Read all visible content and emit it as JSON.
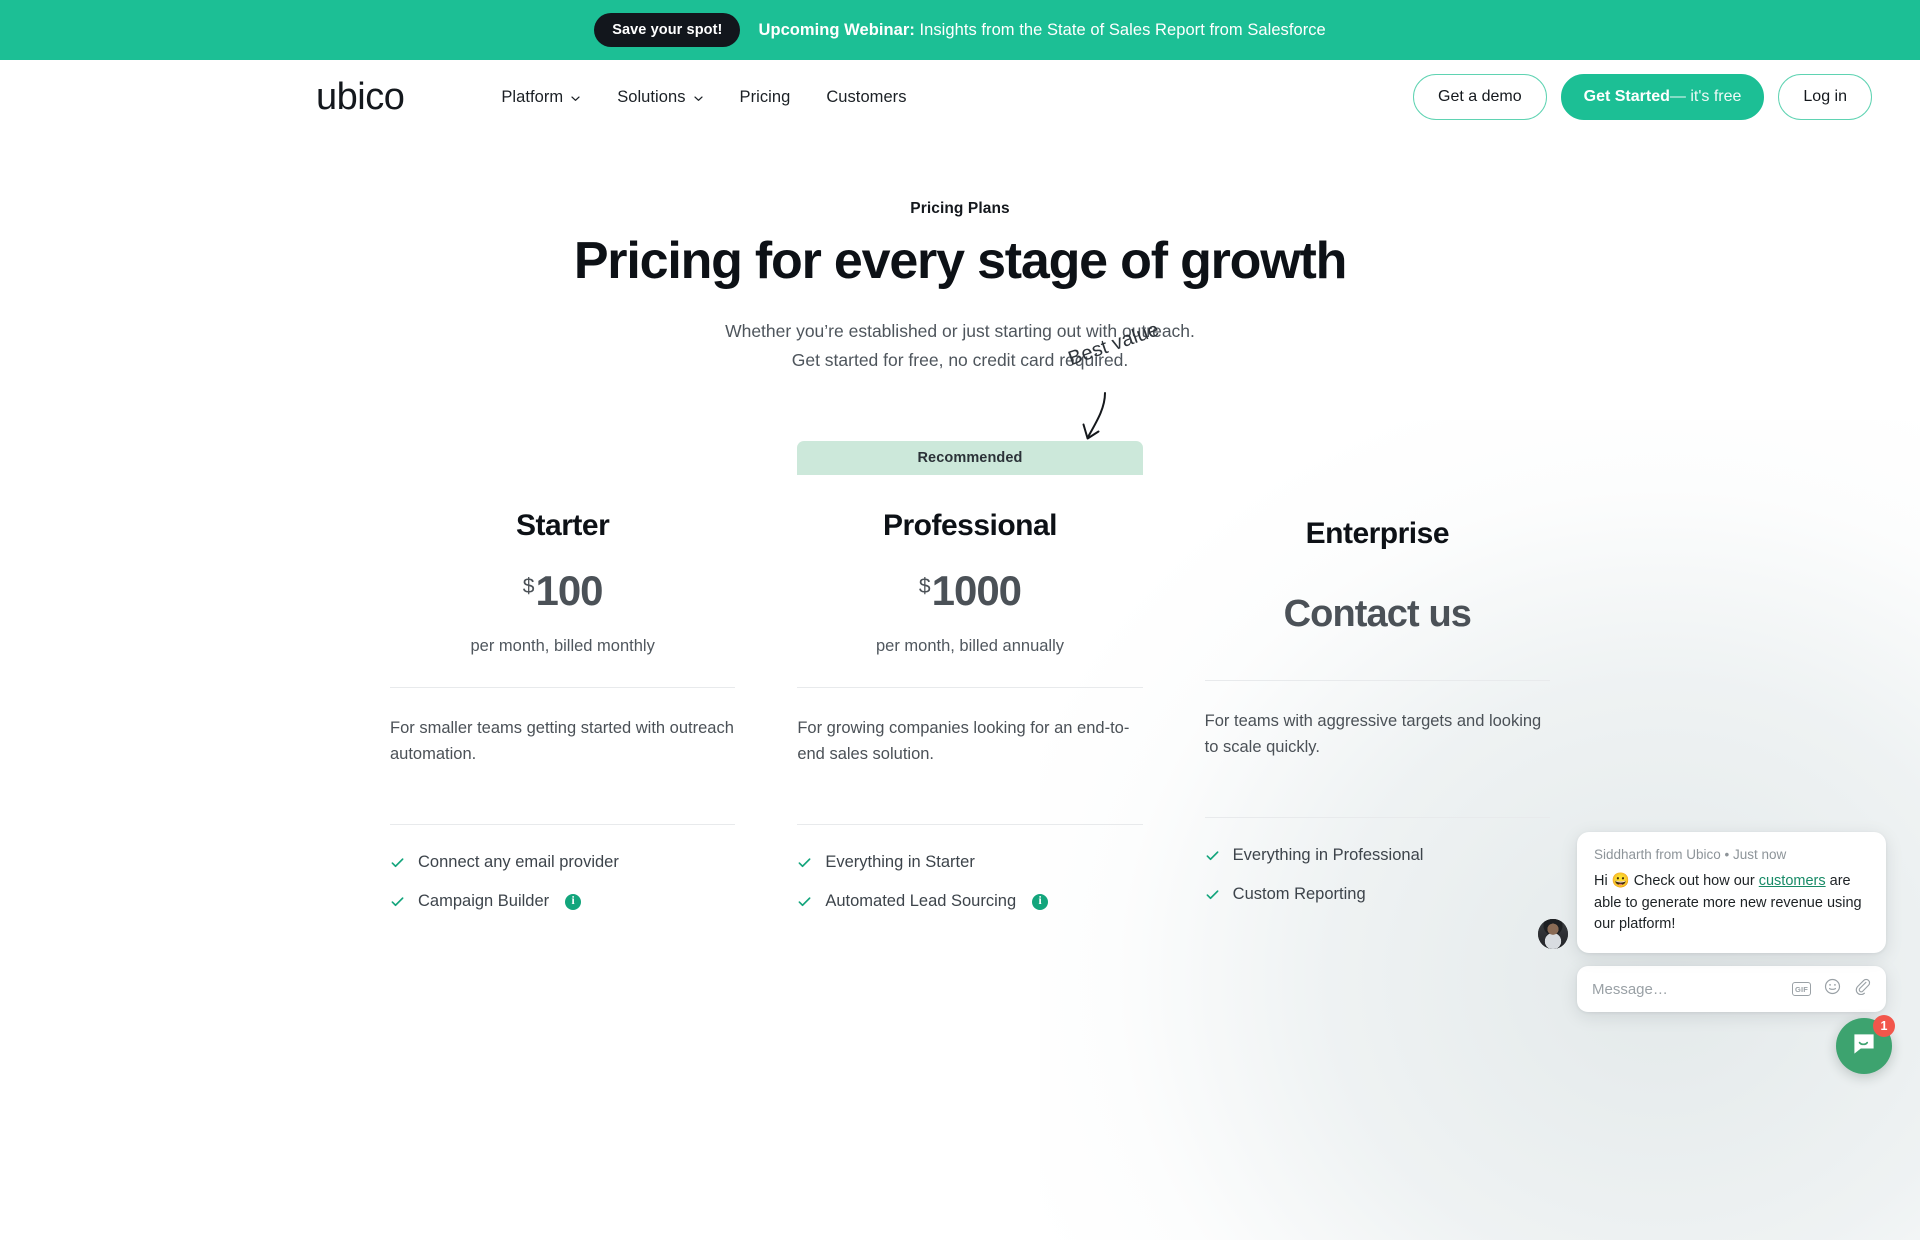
{
  "colors": {
    "brand_green": "#1cbf95",
    "ribbon_green": "#cce8da",
    "check_green": "#13a57c",
    "badge_red": "#f2564b",
    "launcher_green": "#3da36f",
    "dark": "#12161c"
  },
  "announcement": {
    "cta_label": "Save your spot!",
    "lead": "Upcoming Webinar:",
    "text": " Insights from the State of Sales Report from Salesforce"
  },
  "nav": {
    "logo": "ubico",
    "links": [
      {
        "label": "Platform",
        "has_caret": true
      },
      {
        "label": "Solutions",
        "has_caret": true
      },
      {
        "label": "Pricing",
        "has_caret": false
      },
      {
        "label": "Customers",
        "has_caret": false
      }
    ],
    "demo_label": "Get a demo",
    "get_started_strong": "Get Started",
    "get_started_light": "— it's free",
    "login_label": "Log in"
  },
  "hero": {
    "eyebrow": "Pricing Plans",
    "title": "Pricing for every stage of growth",
    "sub_line1": "Whether you’re established or just starting out with outreach.",
    "sub_line2": "Get started for free, no credit card required."
  },
  "annotation": {
    "best_value": "Best value",
    "ribbon": "Recommended"
  },
  "plans": [
    {
      "name": "Starter",
      "currency": "$",
      "amount": "100",
      "period": "per month, billed monthly",
      "description": "For smaller teams getting started with outreach automation.",
      "features": [
        {
          "label": "Connect any email provider",
          "info": false
        },
        {
          "label": "Campaign Builder",
          "info": true
        }
      ]
    },
    {
      "name": "Professional",
      "currency": "$",
      "amount": "1000",
      "period": "per month, billed annually",
      "description": "For growing companies looking for an end-to-end sales solution.",
      "features": [
        {
          "label": "Everything in Starter",
          "info": false
        },
        {
          "label": "Automated Lead Sourcing",
          "info": true
        }
      ]
    },
    {
      "name": "Enterprise",
      "contact_label": "Contact us",
      "description": "For teams with aggressive targets and looking to scale quickly.",
      "features": [
        {
          "label": "Everything in Professional",
          "info": false
        },
        {
          "label": "Custom Reporting",
          "info": false
        }
      ]
    }
  ],
  "chat": {
    "meta": "Siddharth from Ubico • Just now",
    "text_before": "Hi 😀 Check out how our ",
    "link": "customers",
    "text_after": " are able to generate more new revenue using our platform!",
    "input_placeholder": "Message…",
    "gif_label": "GIF",
    "badge_count": "1"
  }
}
